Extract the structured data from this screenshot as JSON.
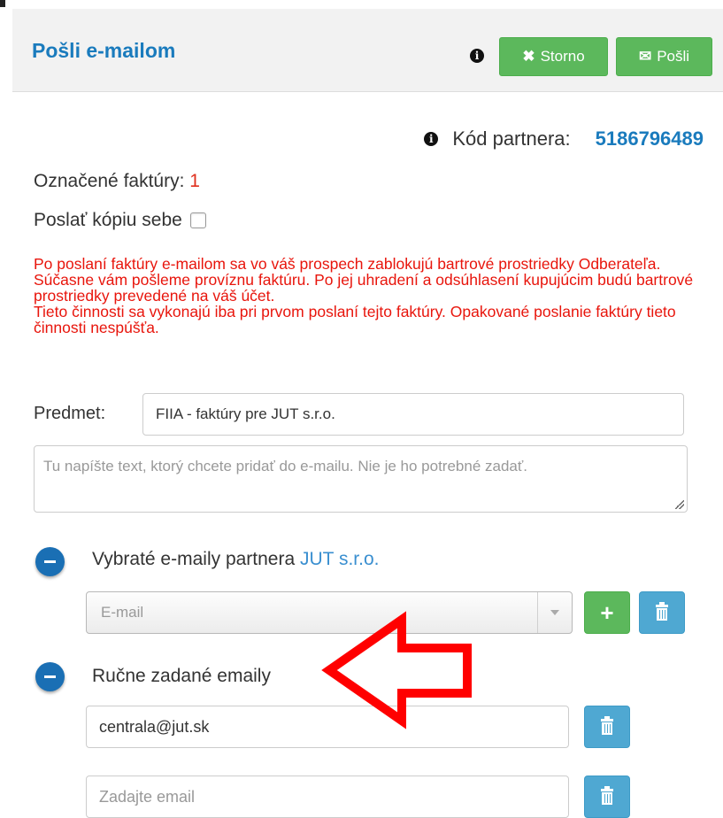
{
  "header": {
    "title": "Pošli e-mailom",
    "storno_label": "Storno",
    "posli_label": "Pošli",
    "info_glyph": "i"
  },
  "partner": {
    "label": "Kód partnera:",
    "code": "5186796489"
  },
  "marked": {
    "label": "Označené faktúry:",
    "count": "1"
  },
  "copy_self": {
    "label": "Poslať kópiu sebe",
    "checked": false
  },
  "warning": {
    "paragraph1": "Po poslaní faktúry e-mailom sa vo váš prospech zablokujú bartrové prostriedky Odberateľa. Súčasne vám pošleme províznu faktúru. Po jej uhradení a odsúhlasení kupujúcim budú bartrové prostriedky prevedené na váš účet.",
    "paragraph2": "Tieto činnosti sa vykonajú iba pri prvom poslaní tejto faktúry. Opakované poslanie faktúry tieto činnosti nespúšťa."
  },
  "subject": {
    "label": "Predmet:",
    "value": "FIIA - faktúry pre JUT s.r.o."
  },
  "message": {
    "placeholder": "Tu napíšte text, ktorý chcete pridať do e-mailu. Nie je ho potrebné zadať."
  },
  "partner_emails": {
    "title": "Vybraté e-maily partnera",
    "partner_name": "JUT s.r.o.",
    "select_placeholder": "E-mail",
    "add_glyph": "+"
  },
  "manual_emails": {
    "title": "Ručne zadané emaily",
    "items": [
      {
        "value": "centrala@jut.sk"
      }
    ],
    "new_placeholder": "Zadajte email"
  },
  "colors": {
    "accent": "#1a7bbd",
    "green": "#5cb85c",
    "blue_button": "#4fa8d2",
    "warning_red": "#e8150c",
    "annotation_arrow": "#ff0000"
  },
  "icons": [
    "info-icon",
    "times-icon",
    "envelope-icon",
    "minus-circle-icon",
    "plus-icon",
    "trash-icon",
    "caret-down-icon",
    "annotation-arrow-icon"
  ]
}
